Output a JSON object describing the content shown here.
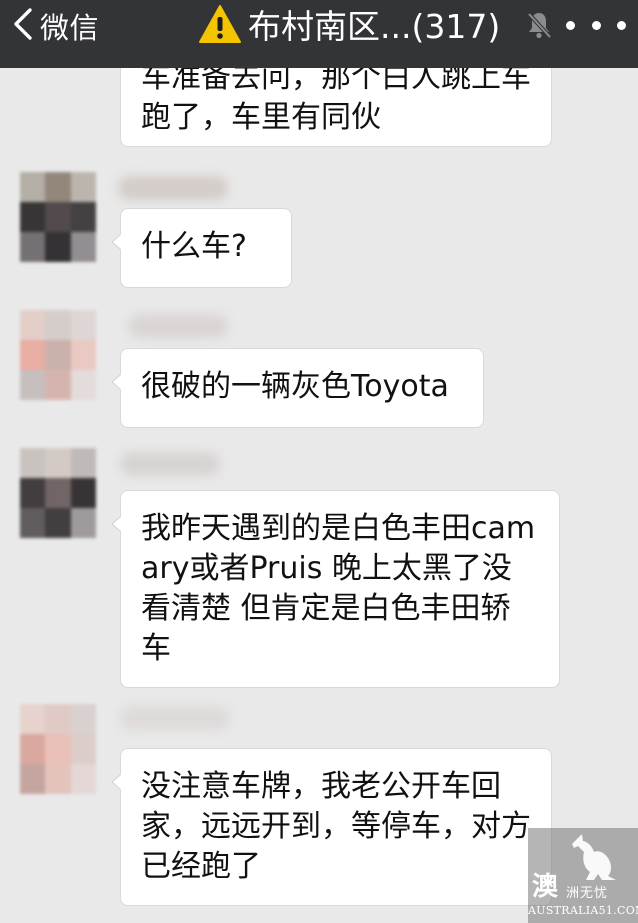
{
  "header": {
    "back_label": "微信",
    "title": "布村南区...(317)",
    "icons": {
      "back": "chevron-left-icon",
      "warning": "warning-triangle-icon",
      "mute": "bell-muted-icon",
      "more": "more-dots-icon"
    },
    "colors": {
      "bar": "#333438",
      "warning": "#f5c400"
    }
  },
  "messages": [
    {
      "text": "车准备去问，那个白人跳上车跑了，车里有同伙",
      "partial": true
    },
    {
      "text": "什么车?"
    },
    {
      "text": "很破的一辆灰色Toyota"
    },
    {
      "text": "我昨天遇到的是白色丰田camary或者Pruis 晚上太黑了没看清楚 但肯定是白色丰田轿车"
    },
    {
      "text": "没注意车牌，我老公开车回家，远远开到，等停车，对方已经跑了"
    }
  ],
  "watermark": {
    "char": "澳",
    "tag": "洲无忧",
    "site": "AUSTRALIA51.COM",
    "icon": "kangaroo-logo-icon"
  }
}
